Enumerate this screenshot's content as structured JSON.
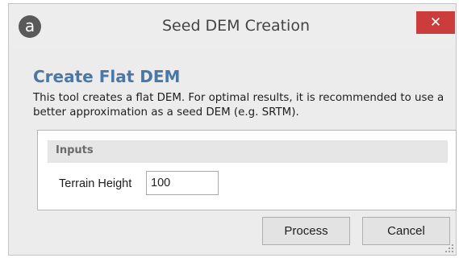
{
  "window": {
    "title": "Seed DEM Creation",
    "app_icon_glyph": "a",
    "close_glyph": "✕",
    "close_color": "#cc3c3c"
  },
  "content": {
    "heading": "Create Flat DEM",
    "heading_color": "#4a78a6",
    "description": "This tool creates a flat DEM. For optimal results, it is recommended to use a better approximation as a seed DEM (e.g. SRTM)."
  },
  "inputs": {
    "section_label": "Inputs",
    "terrain_height_label": "Terrain Height",
    "terrain_height_value": "100"
  },
  "buttons": {
    "process": "Process",
    "cancel": "Cancel"
  },
  "icons": {
    "app": "app-logo-icon",
    "close": "close-icon",
    "resize": "resize-grip-icon"
  }
}
